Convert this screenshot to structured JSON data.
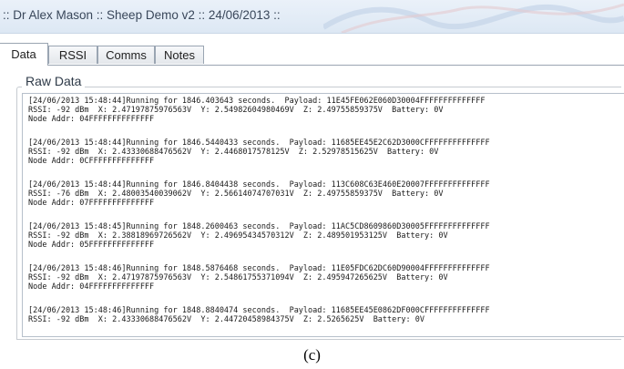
{
  "window": {
    "title": ":: Dr Alex Mason :: Sheep Demo v2 :: 24/06/2013 ::"
  },
  "tabs": [
    {
      "label": "Data"
    },
    {
      "label": "RSSI"
    },
    {
      "label": "Comms"
    },
    {
      "label": "Notes"
    }
  ],
  "raw_data": {
    "label": "Raw Data",
    "entries": [
      {
        "l1": "[24/06/2013 15:48:44]Running for 1846.403643 seconds.  Payload: 11E45FE062E060D30004FFFFFFFFFFFFFF",
        "l2": "RSSI: -92 dBm  X: 2.47197875976563V  Y: 2.54982604980469V  Z: 2.49755859375V  Battery: 0V",
        "l3": "Node Addr: 04FFFFFFFFFFFFFF"
      },
      {
        "l1": "[24/06/2013 15:48:44]Running for 1846.5440433 seconds.  Payload: 11685EE45E2C62D3000CFFFFFFFFFFFFFF",
        "l2": "RSSI: -92 dBm  X: 2.43330688476562V  Y: 2.4468017578125V  Z: 2.52978515625V  Battery: 0V",
        "l3": "Node Addr: 0CFFFFFFFFFFFFFF"
      },
      {
        "l1": "[24/06/2013 15:48:44]Running for 1846.8404438 seconds.  Payload: 113C608C63E460E20007FFFFFFFFFFFFFF",
        "l2": "RSSI: -76 dBm  X: 2.48003540039062V  Y: 2.56614074707031V  Z: 2.49755859375V  Battery: 0V",
        "l3": "Node Addr: 07FFFFFFFFFFFFFF"
      },
      {
        "l1": "[24/06/2013 15:48:45]Running for 1848.2600463 seconds.  Payload: 11AC5CD8609860D30005FFFFFFFFFFFFFF",
        "l2": "RSSI: -92 dBm  X: 2.38818969726562V  Y: 2.49695434570312V  Z: 2.489501953125V  Battery: 0V",
        "l3": "Node Addr: 05FFFFFFFFFFFFFF"
      },
      {
        "l1": "[24/06/2013 15:48:46]Running for 1848.5876468 seconds.  Payload: 11E05FDC62DC60D90004FFFFFFFFFFFFFF",
        "l2": "RSSI: -92 dBm  X: 2.47197875976563V  Y: 2.54861755371094V  Z: 2.495947265625V  Battery: 0V",
        "l3": "Node Addr: 04FFFFFFFFFFFFFF"
      },
      {
        "l1": "[24/06/2013 15:48:46]Running for 1848.8840474 seconds.  Payload: 11685EE45E0862DF000CFFFFFFFFFFFFFF",
        "l2": "RSSI: -92 dBm  X: 2.43330688476562V  Y: 2.44720458984375V  Z: 2.5265625V  Battery: 0V",
        "l3": ""
      }
    ]
  },
  "caption": "(c)"
}
